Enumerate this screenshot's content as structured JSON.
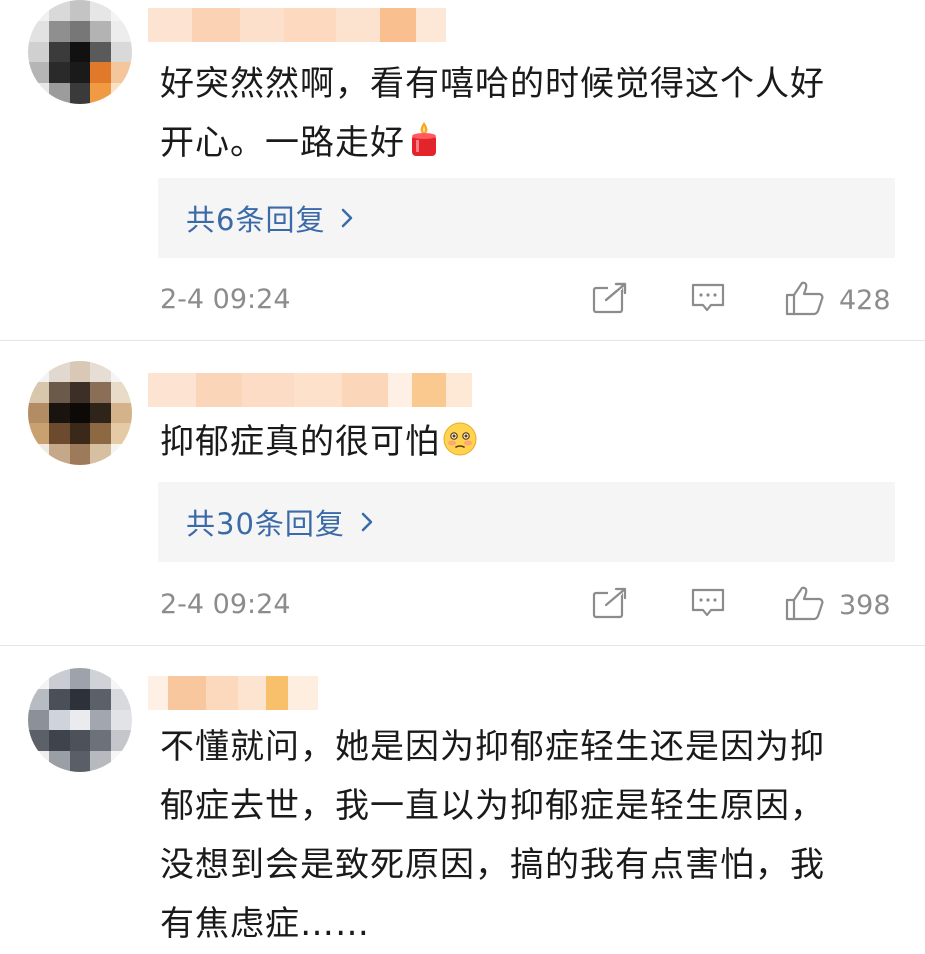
{
  "comments": [
    {
      "text": "好突然然啊，看有嘻哈的时候觉得这个人好\n开心。一路走好",
      "emoji": "candle-emoji",
      "replies_label": "共6条回复",
      "time": "2-4 09:24",
      "likes": "428"
    },
    {
      "text": "抑郁症真的很可怕",
      "emoji": "flushed-face-emoji",
      "replies_label": "共30条回复",
      "time": "2-4 09:24",
      "likes": "398"
    },
    {
      "text": "不懂就问，她是因为抑郁症轻生还是因为抑\n郁症去世，我一直以为抑郁症是轻生原因，\n没想到会是致死原因，搞的我有点害怕，我\n有焦虑症……"
    }
  ],
  "icons": {
    "share": "share-icon",
    "comment": "comment-icon",
    "like": "thumbs-up-icon",
    "chevron": "chevron-right-icon"
  },
  "colors": {
    "reply_link": "#3b6aa8",
    "meta_gray": "#8c8c8c",
    "reply_bg": "#f5f5f5"
  }
}
